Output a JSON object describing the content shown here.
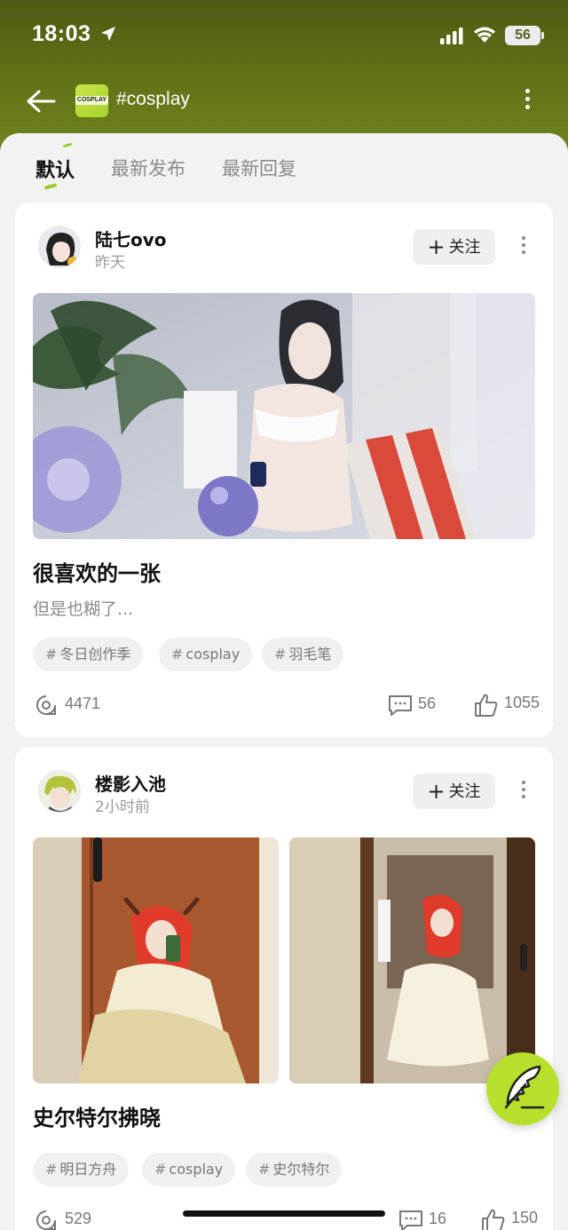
{
  "status_bar": {
    "time": "18:03",
    "battery": "56"
  },
  "header": {
    "topic_title": "#cosplay",
    "topic_logo_text": "COSPLAY"
  },
  "tabs": [
    {
      "label": "默认",
      "active": true
    },
    {
      "label": "最新发布",
      "active": false
    },
    {
      "label": "最新回复",
      "active": false
    }
  ],
  "posts": [
    {
      "username": "陆七ovo",
      "time": "昨天",
      "follow_label": "关注",
      "title": "很喜欢的一张",
      "description": "但是也糊了...",
      "tags": [
        "冬日创作季",
        "cosplay",
        "羽毛笔"
      ],
      "views": "4471",
      "comments": "56",
      "likes": "1055"
    },
    {
      "username": "楼影入池",
      "time": "2小时前",
      "follow_label": "关注",
      "title": "史尔特尔拂晓",
      "tags": [
        "明日方舟",
        "cosplay",
        "史尔特尔"
      ],
      "views": "529",
      "comments": "16",
      "likes": "150"
    }
  ],
  "colors": {
    "accent": "#9ccc2a",
    "fab": "#b6e02b",
    "header_top": "#4f5a12"
  },
  "icons": {
    "back": "back-arrow-icon",
    "more": "more-vertical-icon",
    "views": "view-icon",
    "comments": "comment-icon",
    "likes": "thumbs-up-icon",
    "compose": "feather-pen-icon"
  }
}
